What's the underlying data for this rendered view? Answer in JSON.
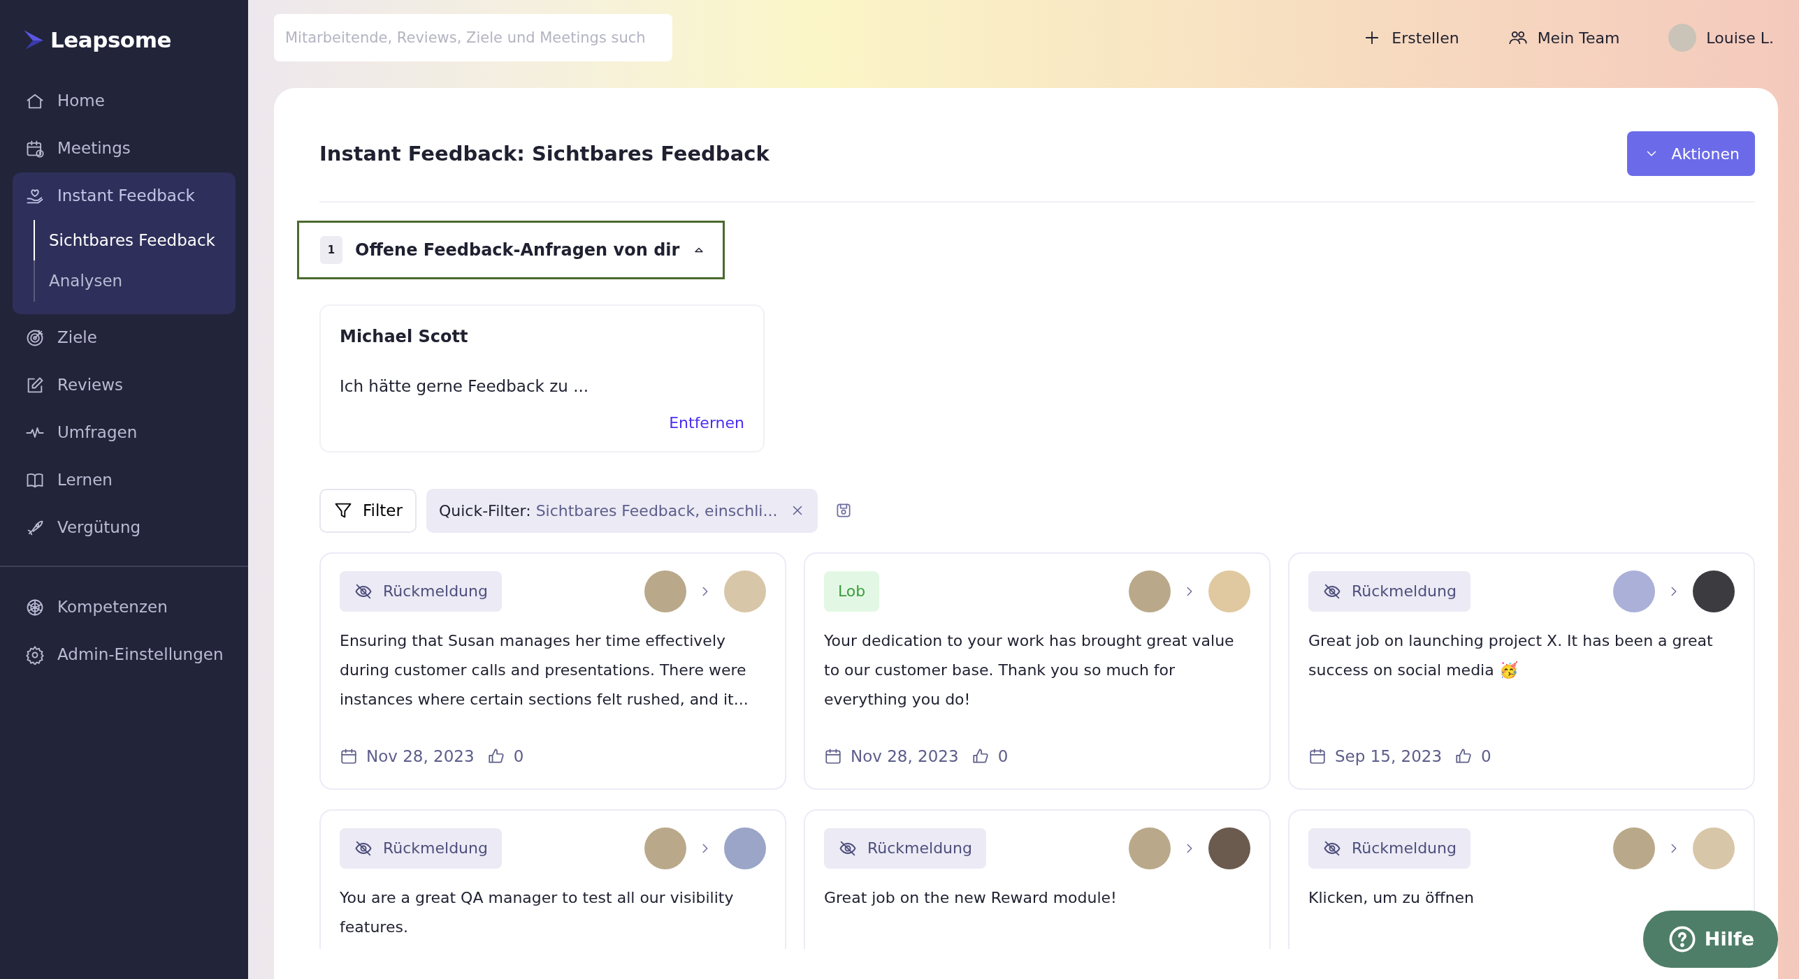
{
  "brand": {
    "name": "Leapsome"
  },
  "sidebar": {
    "items": [
      {
        "label": "Home",
        "selected": false
      },
      {
        "label": "Meetings",
        "selected": false
      },
      {
        "label": "Instant Feedback",
        "selected": true,
        "expanded": true,
        "children": [
          {
            "label": "Sichtbares Feedback",
            "selected": true
          },
          {
            "label": "Analysen",
            "selected": false
          }
        ]
      },
      {
        "label": "Ziele",
        "selected": false
      },
      {
        "label": "Reviews",
        "selected": false
      },
      {
        "label": "Umfragen",
        "selected": false
      },
      {
        "label": "Lernen",
        "selected": false
      },
      {
        "label": "Vergütung",
        "selected": false
      }
    ],
    "bottom_items": [
      {
        "label": "Kompetenzen",
        "selected": false
      },
      {
        "label": "Admin-Einstellungen",
        "selected": false
      }
    ]
  },
  "header": {
    "search": {
      "placeholder": "Mitarbeitende, Reviews, Ziele und Meetings such"
    },
    "actions": [
      {
        "label": "Erstellen"
      },
      {
        "label": "Mein Team"
      },
      {
        "label": "Louise L."
      }
    ]
  },
  "page": {
    "title": "Instant Feedback: Sichtbares Feedback",
    "actions_button": "Aktionen"
  },
  "open_requests": {
    "count": "1",
    "title": "Offene Feedback-Anfragen von dir",
    "expanded": true,
    "items": [
      {
        "name": "Michael Scott",
        "text": "Ich hätte gerne Feedback zu ...",
        "action": "Entfernen"
      }
    ]
  },
  "filter": {
    "button": "Filter",
    "quick_filter_label": "Quick-Filter:",
    "quick_filter_value": "Sichtbares Feedback, einschli..."
  },
  "feedback_cards": [
    {
      "kind": "private",
      "tag": "Rückmeldung",
      "text": "Ensuring that Susan manages her time effectively during customer calls and presentations. There were instances where certain sections felt rushed, and it...",
      "date": "Nov 28, 2023",
      "likes": "0"
    },
    {
      "kind": "praise",
      "tag": "Lob",
      "text": "Your dedication to your work has brought great value to our customer base. Thank you so much for everything you do!",
      "date": "Nov 28, 2023",
      "likes": "0"
    },
    {
      "kind": "private",
      "tag": "Rückmeldung",
      "text": "Great job on launching project X. It has been a great success on social media 🥳",
      "date": "Sep 15, 2023",
      "likes": "0"
    },
    {
      "kind": "private",
      "tag": "Rückmeldung",
      "text": "You are a great QA manager to test all our visibility features."
    },
    {
      "kind": "private",
      "tag": "Rückmeldung",
      "text": "Great job on the new Reward module!"
    },
    {
      "kind": "private",
      "tag": "Rückmeldung",
      "text": "Klicken, um zu öffnen"
    }
  ],
  "help_button": {
    "label": "Hilfe"
  }
}
